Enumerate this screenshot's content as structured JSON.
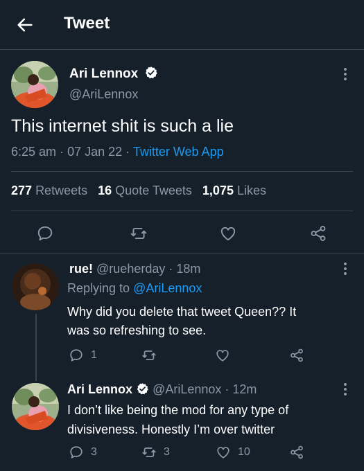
{
  "header": {
    "title": "Tweet"
  },
  "main_tweet": {
    "display_name": "Ari Lennox",
    "handle": "@AriLennox",
    "text": "This internet shit is such a lie",
    "time": "6:25 am",
    "sep1": "·",
    "date": "07 Jan 22",
    "sep2": "·",
    "source": "Twitter Web App",
    "stats": {
      "retweets_num": "277",
      "retweets_label": "Retweets",
      "quotes_num": "16",
      "quotes_label": "Quote Tweets",
      "likes_num": "1,075",
      "likes_label": "Likes"
    }
  },
  "reply1": {
    "display_name": "rue!",
    "handle": "@rueherday",
    "sep": "·",
    "time": "18m",
    "replying_prefix": "Replying to",
    "replying_to": "@AriLennox",
    "text_line1": "Why did you delete that tweet Queen?? It",
    "text_line2": "was so refreshing to see.",
    "reply_count": "1"
  },
  "reply2": {
    "display_name": "Ari Lennox",
    "handle": "@AriLennox",
    "sep": "·",
    "time": "12m",
    "text_line1": "I don’t like being the mod for any type of",
    "text_line2": "divisiveness. Honestly I’m over twitter",
    "reply_count": "3",
    "retweet_count": "3",
    "like_count": "10"
  },
  "colors": {
    "background": "#15202b",
    "accent": "#1d9bf0",
    "muted": "#8b98a5",
    "border": "#38444d"
  }
}
